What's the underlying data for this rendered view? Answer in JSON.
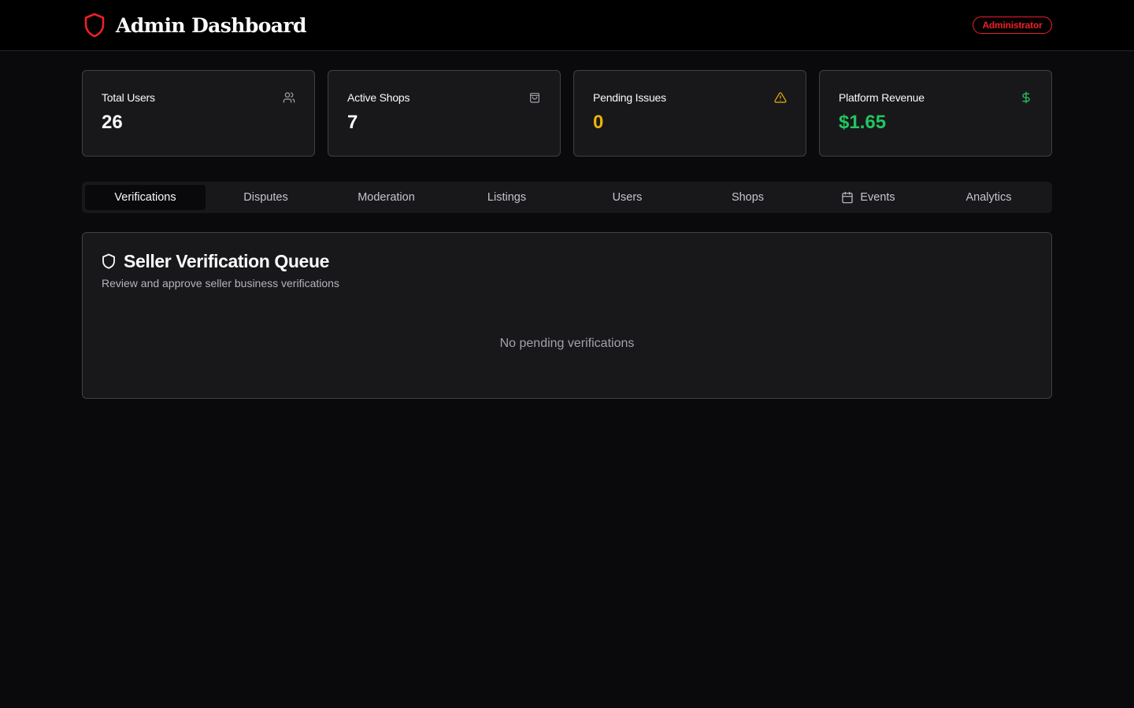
{
  "header": {
    "title": "Admin Dashboard",
    "icon": "shield-icon",
    "role_badge": "Administrator",
    "accent": "#ef1f28"
  },
  "stats": [
    {
      "label": "Total Users",
      "value": "26",
      "icon": "users-icon",
      "color": "#fafafa"
    },
    {
      "label": "Active Shops",
      "value": "7",
      "icon": "shopping-bag-icon",
      "color": "#fafafa"
    },
    {
      "label": "Pending Issues",
      "value": "0",
      "icon": "alert-triangle-icon",
      "color": "#eab308"
    },
    {
      "label": "Platform Revenue",
      "value": "$1.65",
      "icon": "dollar-sign-icon",
      "color": "#22c55e"
    }
  ],
  "tabs": [
    {
      "label": "Verifications",
      "active": true
    },
    {
      "label": "Disputes"
    },
    {
      "label": "Moderation"
    },
    {
      "label": "Listings"
    },
    {
      "label": "Users"
    },
    {
      "label": "Shops"
    },
    {
      "label": "Events",
      "icon": "calendar-icon"
    },
    {
      "label": "Analytics"
    }
  ],
  "panel": {
    "title": "Seller Verification Queue",
    "subtitle": "Review and approve seller business verifications",
    "empty_message": "No pending verifications",
    "icon": "shield-icon"
  }
}
